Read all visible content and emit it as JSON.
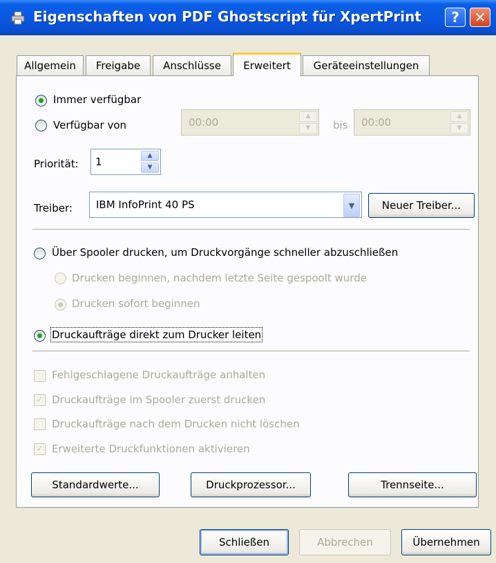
{
  "window": {
    "title": "Eigenschaften von PDF Ghostscript für XpertPrint"
  },
  "titlebar": {
    "help_label": "?",
    "close_label": "✕"
  },
  "tabs": [
    {
      "label": "Allgemein"
    },
    {
      "label": "Freigabe"
    },
    {
      "label": "Anschlüsse"
    },
    {
      "label": "Erweitert"
    },
    {
      "label": "Geräteeinstellungen"
    }
  ],
  "availability": {
    "always_label": "Immer verfügbar",
    "from_label": "Verfügbar von",
    "from_value": "00:00",
    "to_label": "bis",
    "to_value": "00:00"
  },
  "priority": {
    "label": "Priorität:",
    "value": "1"
  },
  "driver": {
    "label": "Treiber:",
    "value": "IBM InfoPrint 40 PS",
    "new_button": "Neuer Treiber..."
  },
  "spool": {
    "spool_label": "Über Spooler drucken, um Druckvorgänge schneller abzuschließen",
    "after_last_page_label": "Drucken beginnen, nachdem letzte Seite gespoolt wurde",
    "immediately_label": "Drucken sofort beginnen",
    "direct_label": "Druckaufträge direkt zum Drucker leiten"
  },
  "options": [
    {
      "label": "Fehlgeschlagene Druckaufträge anhalten",
      "checked": false
    },
    {
      "label": "Druckaufträge im Spooler zuerst drucken",
      "checked": true
    },
    {
      "label": "Druckaufträge nach dem Drucken nicht löschen",
      "checked": false
    },
    {
      "label": "Erweiterte Druckfunktionen aktivieren",
      "checked": true
    }
  ],
  "panel_buttons": {
    "defaults": "Standardwerte...",
    "processor": "Druckprozessor...",
    "separator": "Trennseite..."
  },
  "footer": {
    "close": "Schließen",
    "cancel": "Abbrechen",
    "apply": "Übernehmen"
  },
  "icons": {
    "title_icon": "printer-icon",
    "check": "✓",
    "spin_up": "▲",
    "spin_down": "▼",
    "combo": "▼"
  }
}
